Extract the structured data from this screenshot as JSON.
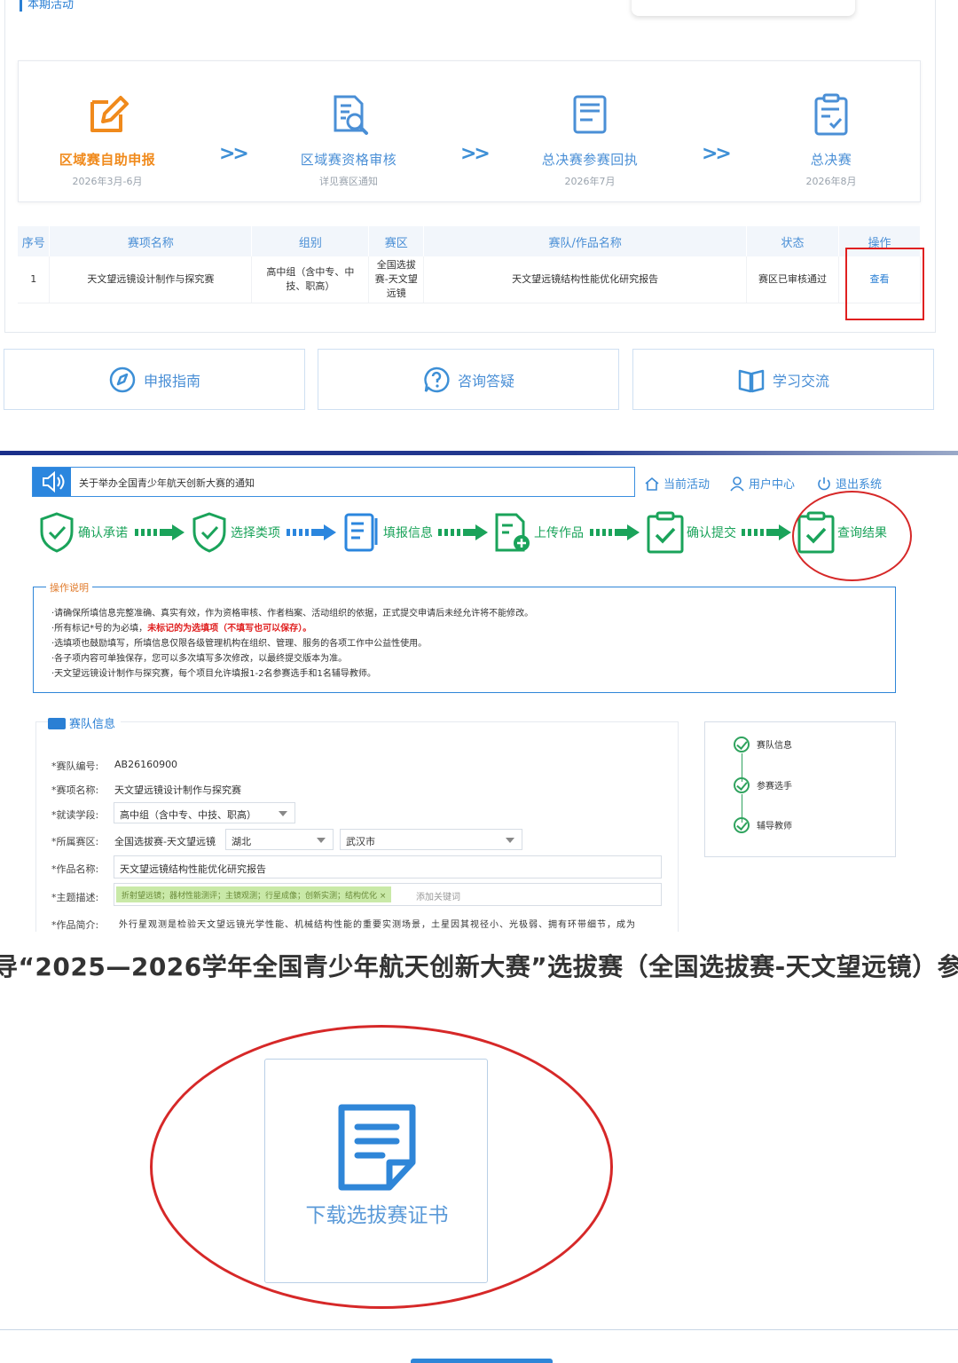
{
  "section1": {
    "top_label": "本期活动",
    "steps": [
      {
        "title": "区域赛自助申报",
        "date": "2026年3月-6月",
        "color": "#f08a1c"
      },
      {
        "title": "区域赛资格审核",
        "date": "详见赛区通知",
        "color": "#4a8fd6"
      },
      {
        "title": "总决赛参赛回执",
        "date": "2026年7月",
        "color": "#4a8fd6"
      },
      {
        "title": "总决赛",
        "date": "2026年8月",
        "color": "#4a8fd6"
      }
    ],
    "table": {
      "headers": [
        "序号",
        "赛项名称",
        "组别",
        "赛区",
        "赛队/作品名称",
        "状态",
        "操作"
      ],
      "row": {
        "index": "1",
        "event": "天文望远镜设计制作与探究赛",
        "group": "高中组（含中专、中技、职高）",
        "zone": "全国选拔赛-天文望远镜",
        "work": "天文望远镜结构性能优化研究报告",
        "status": "赛区已审核通过",
        "action": "查看"
      }
    },
    "nav_buttons": [
      {
        "label": "申报指南",
        "icon": "compass-icon"
      },
      {
        "label": "咨询答疑",
        "icon": "question-icon"
      },
      {
        "label": "学习交流",
        "icon": "book-icon"
      }
    ]
  },
  "section2": {
    "notice": "关于举办全国青少年航天创新大赛的通知",
    "topnav": {
      "current": "当前活动",
      "user": "用户中心",
      "logout": "退出系统"
    },
    "flow": [
      "确认承诺",
      "选择类项",
      "填报信息",
      "上传作品",
      "确认提交",
      "查询结果"
    ],
    "ops_title": "操作说明",
    "ops_lines": [
      "·请确保所填信息完整准确、真实有效，作为资格审核、作者档案、活动组织的依据，正式提交申请后未经允许将不能修改。",
      "·所有标记*号的为必填，",
      "未标记的为选填项（不填写也可以保存）",
      "。",
      "·选填项也鼓励填写，所填信息仅限各级管理机构在组织、管理、服务的各项工作中公益性使用。",
      "·各子项内容可单独保存，您可以多次填写多次修改，以最终提交版本为准。",
      "·天文望远镜设计制作与探究赛，每个项目允许填报1-2名参赛选手和1名辅导教师。"
    ],
    "team": {
      "heading": "赛队信息",
      "fields": {
        "team_no_label": "*赛队编号:",
        "team_no": "AB26160900",
        "event_label": "*赛项名称:",
        "event": "天文望远镜设计制作与探究赛",
        "stage_label": "*就读学段:",
        "stage": "高中组（含中专、中技、职高）",
        "zone_label": "*所属赛区:",
        "zone": "全国选拔赛-天文望远镜",
        "province": "湖北",
        "city": "武汉市",
        "work_label": "*作品名称:",
        "work": "天文望远镜结构性能优化研究报告",
        "theme_label": "*主题描述:",
        "theme_tag": "折射望远镜；器材性能测评；主镜观测；行星成像；创新实测；结构优化 ×",
        "theme_placeholder": "添加关键词",
        "intro_label": "*作品简介:",
        "intro": "外行星观测是检验天文望远镜光学性能、机械结构性能的重要实测场景，土星因其视径小、光极弱、拥有环带细节，成为"
      }
    },
    "side_items": [
      "赛队信息",
      "参赛选手",
      "辅导教师"
    ]
  },
  "section3": {
    "headline": "导“2025—2026学年全国青少年航天创新大赛”选拔赛（全国选拔赛-天文望远镜）参",
    "download_label": "下载选拔赛证书"
  },
  "colors": {
    "accent": "#2a7fd4",
    "orange": "#f08a1c",
    "green": "#1aa35a",
    "red": "#d62828"
  }
}
